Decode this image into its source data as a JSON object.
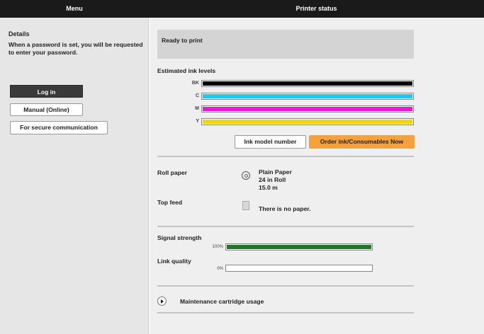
{
  "header": {
    "menu_title": "Menu",
    "status_title": "Printer status"
  },
  "sidebar": {
    "details_title": "Details",
    "password_note": "When a password is set, you will be requested to enter your password.",
    "login_label": "Log in",
    "manual_label": "Manual (Online)",
    "secure_label": "For secure communication"
  },
  "status": {
    "message": "Ready to print"
  },
  "ink": {
    "title": "Estimated ink levels",
    "levels": [
      {
        "label": "BK",
        "color": "#000000",
        "level": 1.0
      },
      {
        "label": "C",
        "color": "#1fc8f0",
        "level": 1.0
      },
      {
        "label": "M",
        "color": "#e51ad6",
        "level": 1.0
      },
      {
        "label": "Y",
        "color": "#f7d509",
        "level": 1.0
      }
    ],
    "model_button": "Ink model number",
    "order_button": "Order ink/Consumables Now"
  },
  "paper": {
    "roll_label": "Roll paper",
    "roll_line1": "Plain Paper",
    "roll_line2": "24 in Roll",
    "roll_line3": "15.0 m",
    "topfeed_label": "Top feed",
    "topfeed_status": "There is no paper."
  },
  "network": {
    "signal_label": "Signal strength",
    "signal_pct_text": "100%",
    "signal_value": 100,
    "link_label": "Link quality",
    "link_pct_text": "0%",
    "link_value": 0,
    "fill_color": "#1b7a1b"
  },
  "maintenance": {
    "label": "Maintenance cartridge usage"
  }
}
